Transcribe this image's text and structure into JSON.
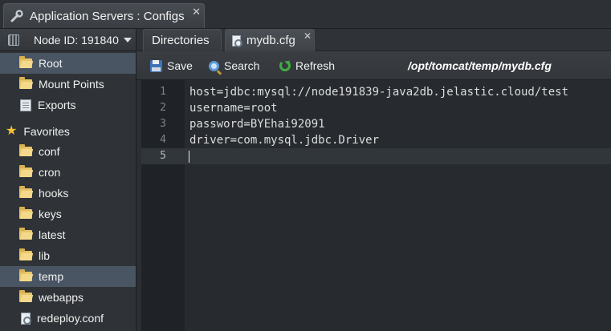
{
  "window": {
    "title": "Application Servers : Configs"
  },
  "sidebar": {
    "node_label": "Node ID: 191840",
    "items": [
      {
        "label": "Root",
        "icon": "folder-open-icon",
        "selected": true
      },
      {
        "label": "Mount Points",
        "icon": "folder-icon",
        "selected": false
      },
      {
        "label": "Exports",
        "icon": "exports-icon",
        "selected": false
      },
      {
        "label": "Favorites",
        "icon": "star-icon",
        "selected": false
      },
      {
        "label": "conf",
        "icon": "folder-icon",
        "selected": false
      },
      {
        "label": "cron",
        "icon": "folder-icon",
        "selected": false
      },
      {
        "label": "hooks",
        "icon": "folder-icon",
        "selected": false
      },
      {
        "label": "keys",
        "icon": "folder-icon",
        "selected": false
      },
      {
        "label": "latest",
        "icon": "folder-icon",
        "selected": false
      },
      {
        "label": "lib",
        "icon": "folder-icon",
        "selected": false
      },
      {
        "label": "temp",
        "icon": "folder-icon",
        "selected": true
      },
      {
        "label": "webapps",
        "icon": "folder-icon",
        "selected": false
      },
      {
        "label": "redeploy.conf",
        "icon": "file-icon",
        "selected": false
      }
    ]
  },
  "tabs": [
    {
      "label": "Directories",
      "active": false
    },
    {
      "label": "mydb.cfg",
      "active": true
    }
  ],
  "toolbar": {
    "save_label": "Save",
    "search_label": "Search",
    "refresh_label": "Refresh",
    "path": "/opt/tomcat/temp/mydb.cfg"
  },
  "editor": {
    "lines": [
      {
        "num": "1",
        "text": "host=jdbc:mysql://node191839-java2db.jelastic.cloud/test"
      },
      {
        "num": "2",
        "text": "username=root"
      },
      {
        "num": "3",
        "text": "password=BYEhai92091"
      },
      {
        "num": "4",
        "text": "driver=com.mysql.jdbc.Driver"
      },
      {
        "num": "5",
        "text": ""
      }
    ],
    "current_line": 5
  },
  "colors": {
    "selection": "#4a5563",
    "background": "#2b2f33",
    "editor_bg": "#272b30"
  }
}
